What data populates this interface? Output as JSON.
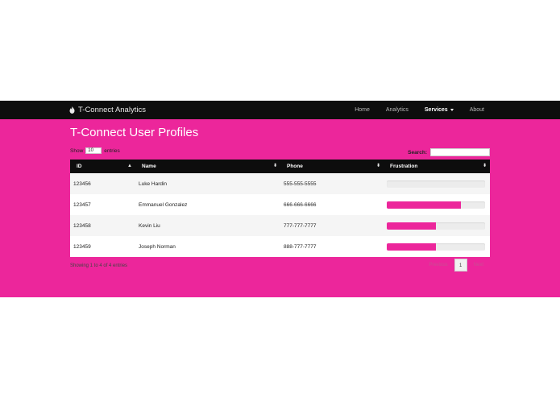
{
  "navbar": {
    "brand": "T-Connect Analytics",
    "links": [
      {
        "label": "Home"
      },
      {
        "label": "Analytics"
      },
      {
        "label": "Services"
      },
      {
        "label": "About"
      }
    ]
  },
  "page": {
    "title": "T-Connect User Profiles"
  },
  "controls": {
    "show_label": "Show",
    "entries_value": "10",
    "entries_label": "entries",
    "search_label": "Search:",
    "search_value": ""
  },
  "table": {
    "columns": [
      "ID",
      "Name",
      "Phone",
      "Frustration"
    ],
    "rows": [
      {
        "id": "123456",
        "name": "Luke Hardin",
        "phone": "555-555-5555",
        "frustration": 0
      },
      {
        "id": "123457",
        "name": "Emmanuel Gonzalez",
        "phone": "666-666-6666",
        "frustration": 75
      },
      {
        "id": "123458",
        "name": "Kevin Liu",
        "phone": "777-777-7777",
        "frustration": 50
      },
      {
        "id": "123459",
        "name": "Joseph Norman",
        "phone": "888-777-7777",
        "frustration": 50
      }
    ]
  },
  "footer": {
    "info": "Showing 1 to 4 of 4 entries",
    "previous": "Previous",
    "current_page": "1",
    "next": "Next"
  },
  "colors": {
    "accent": "#ec269b",
    "navbar": "#0d0d0d"
  }
}
